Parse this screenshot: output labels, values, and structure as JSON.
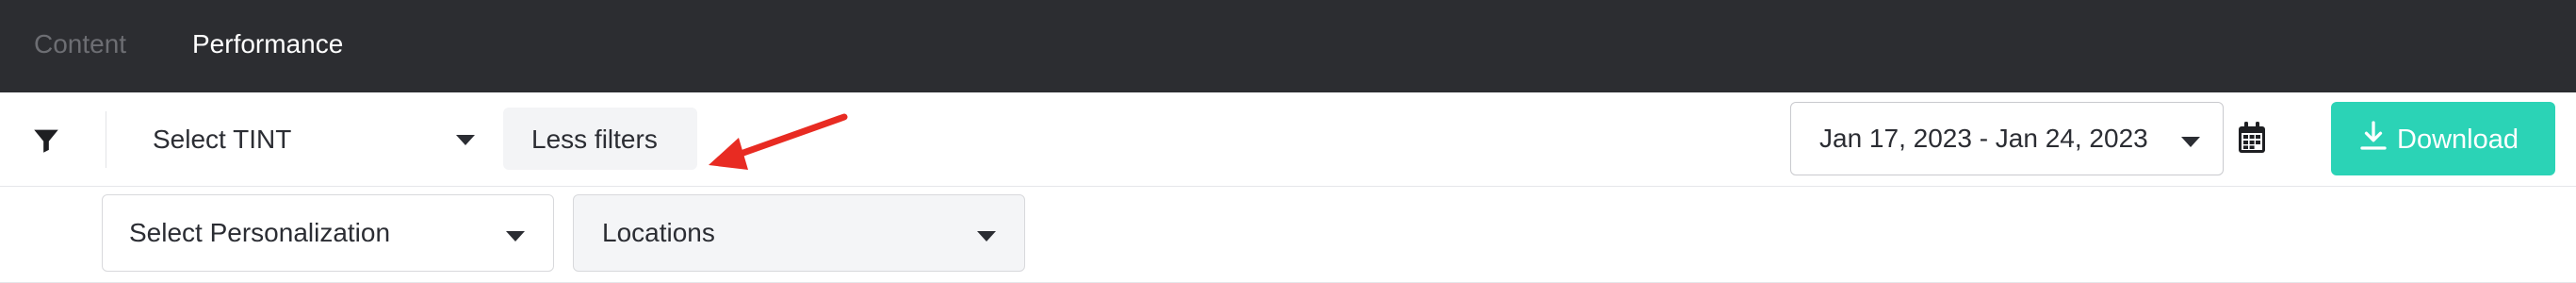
{
  "nav": {
    "tabs": [
      {
        "label": "Content"
      },
      {
        "label": "Performance"
      }
    ],
    "active_tab": "Performance"
  },
  "filters": {
    "filter_icon": "filter-icon",
    "select_tint": {
      "value": "Select TINT"
    },
    "toggle_label": "Less filters",
    "date_range": {
      "value": "Jan 17, 2023 - Jan 24, 2023"
    },
    "calendar_icon": "calendar-icon",
    "download": {
      "label": "Download",
      "icon": "download-icon"
    },
    "select_personalization": {
      "value": "Select Personalization"
    },
    "locations": {
      "value": "Locations"
    }
  },
  "annotation": {
    "arrow_color": "#e82b22"
  },
  "colors": {
    "nav_bg": "#2c2d31",
    "accent": "#2bd3b6",
    "inactive_tab": "#6d6e73"
  }
}
